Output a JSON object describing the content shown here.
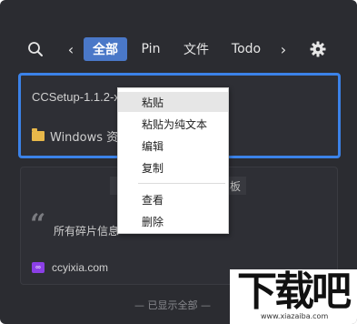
{
  "toolbar": {
    "search_icon": "search-icon",
    "prev_glyph": "‹",
    "next_glyph": "›",
    "tabs": [
      {
        "label": "全部",
        "active": true
      },
      {
        "label": "Pin"
      },
      {
        "label": "文件"
      },
      {
        "label": "Todo"
      }
    ],
    "settings_icon": "gear-icon"
  },
  "clips": [
    {
      "title": "CCSetup-1.1.2-x",
      "source": "Windows 资源",
      "source_icon": "folder-icon",
      "selected": true
    },
    {
      "header_text": "板",
      "quote_glyph": "“",
      "text": "所有碎片信息",
      "link": "ccyixia.com",
      "link_icon": "link-icon"
    }
  ],
  "footer": {
    "text": "— 已显示全部 —"
  },
  "context_menu": {
    "items": [
      "粘贴",
      "粘贴为纯文本",
      "编辑",
      "复制",
      "查看",
      "删除"
    ],
    "hovered_index": 0
  },
  "watermark": {
    "logo": "下载吧",
    "url": "www.xiazaiba.com"
  },
  "colors": {
    "background": "#2b2c31",
    "accent": "#4a78c8",
    "selection_border": "#3b82e8",
    "menu_background": "#ffffff"
  }
}
